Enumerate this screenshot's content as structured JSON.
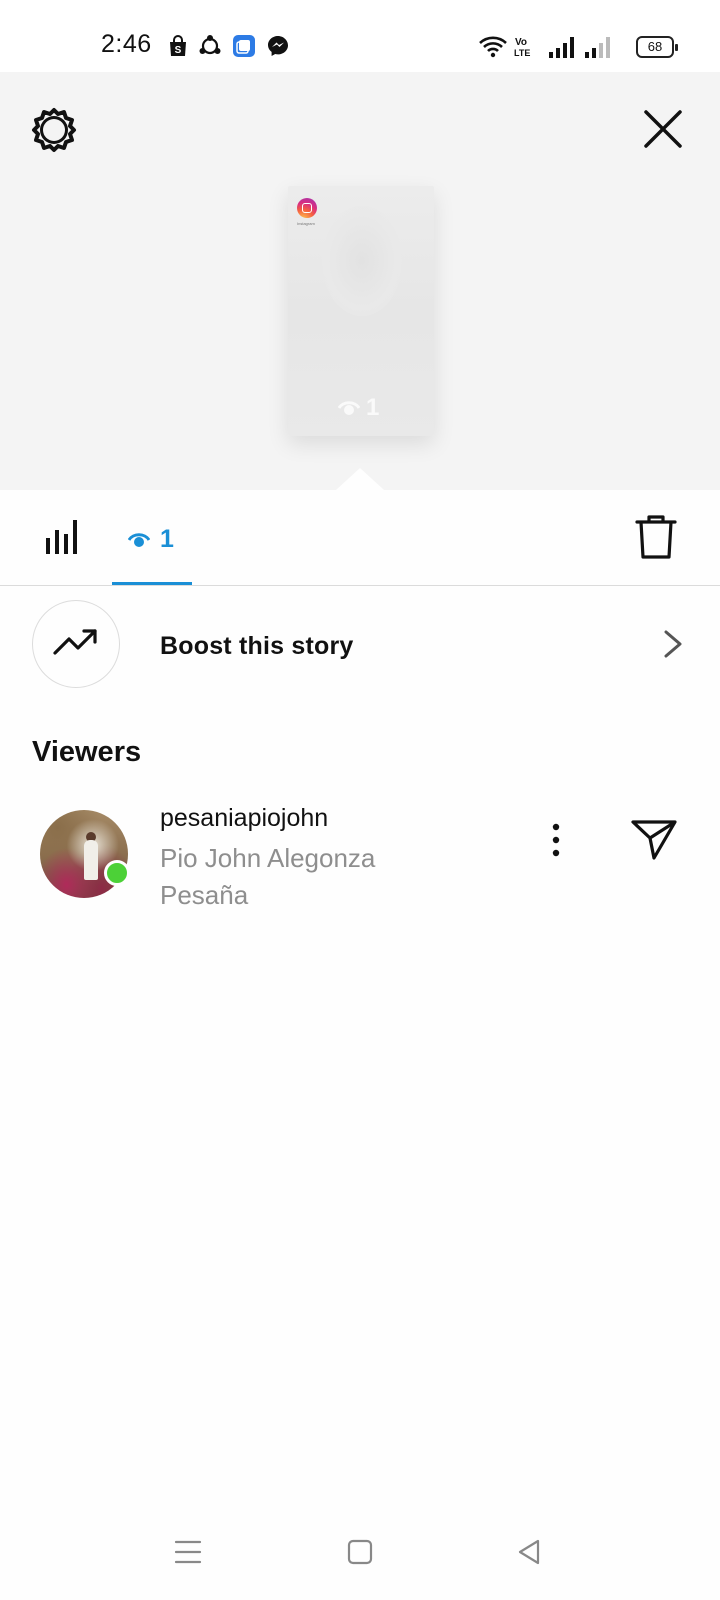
{
  "status_bar": {
    "time": "2:46",
    "battery": "68",
    "network_label": "Vo LTE"
  },
  "story_preview": {
    "view_count": "1",
    "app_label": "Instagram"
  },
  "tabs": {
    "viewers_count": "1"
  },
  "boost": {
    "label": "Boost this story"
  },
  "viewers": {
    "heading": "Viewers",
    "items": [
      {
        "username": "pesaniapiojohn",
        "full_name": "Pio John Alegonza Pesaña",
        "online": true
      }
    ]
  },
  "colors": {
    "accent": "#1a8fd6",
    "online": "#4cd137",
    "secondary_text": "#8e8e8e"
  }
}
